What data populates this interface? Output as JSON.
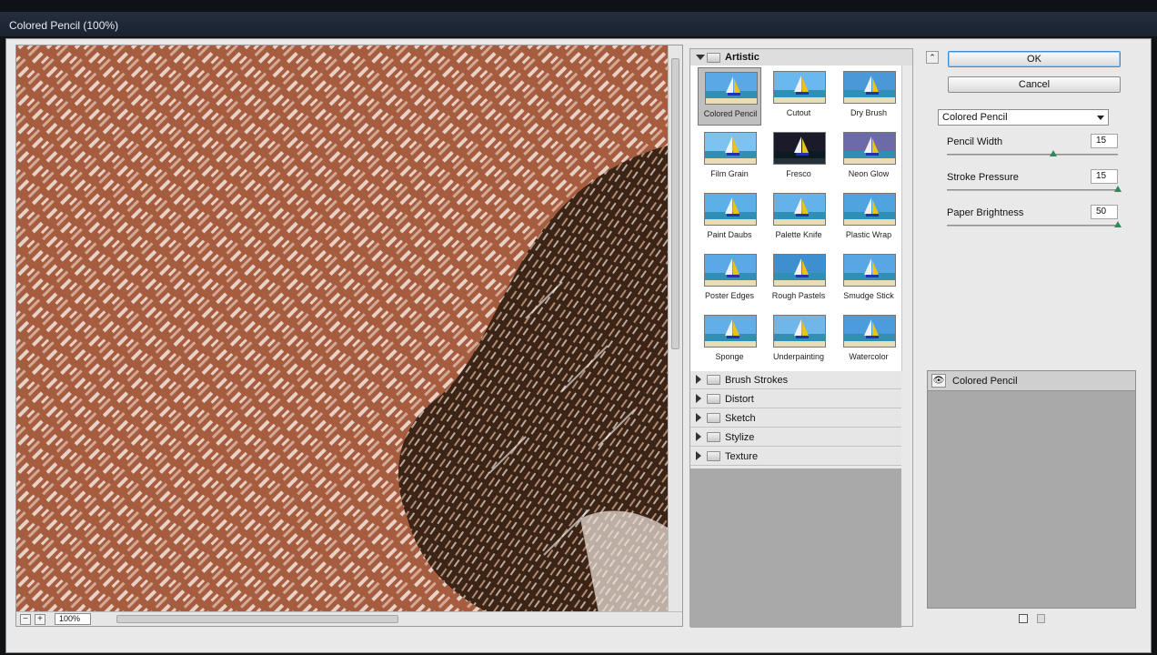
{
  "window": {
    "title": "Colored Pencil (100%)"
  },
  "preview": {
    "zoom": "100%",
    "minus_label": "−",
    "plus_label": "+"
  },
  "gallery": {
    "open_category": "Artistic",
    "filters": [
      {
        "label": "Colored Pencil",
        "selected": true
      },
      {
        "label": "Cutout"
      },
      {
        "label": "Dry Brush"
      },
      {
        "label": "Film Grain"
      },
      {
        "label": "Fresco"
      },
      {
        "label": "Neon Glow"
      },
      {
        "label": "Paint Daubs"
      },
      {
        "label": "Palette Knife"
      },
      {
        "label": "Plastic Wrap"
      },
      {
        "label": "Poster Edges"
      },
      {
        "label": "Rough Pastels"
      },
      {
        "label": "Smudge Stick"
      },
      {
        "label": "Sponge"
      },
      {
        "label": "Underpainting"
      },
      {
        "label": "Watercolor"
      }
    ],
    "collapsed_categories": [
      "Brush Strokes",
      "Distort",
      "Sketch",
      "Stylize",
      "Texture"
    ]
  },
  "settings": {
    "collapse_label": "⌃",
    "ok_label": "OK",
    "cancel_label": "Cancel",
    "selected_filter": "Colored Pencil",
    "params": [
      {
        "label": "Pencil Width",
        "value": "15",
        "fraction": 0.62
      },
      {
        "label": "Stroke Pressure",
        "value": "15",
        "fraction": 1.0
      },
      {
        "label": "Paper Brightness",
        "value": "50",
        "fraction": 1.0
      }
    ]
  },
  "layers": {
    "items": [
      {
        "label": "Colored Pencil",
        "visible_icon": "👁"
      }
    ]
  },
  "colors": {
    "accent_focus": "#3d8cd6",
    "slider_knob": "#2f8a5e",
    "canvas_brown": "#a0563a"
  }
}
